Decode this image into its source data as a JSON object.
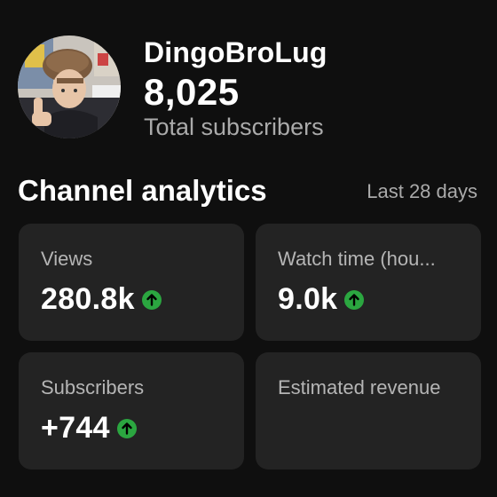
{
  "channel": {
    "name": "DingoBroLug",
    "subscriber_count": "8,025",
    "subscriber_label": "Total subscribers"
  },
  "analytics": {
    "title": "Channel analytics",
    "range": "Last 28 days",
    "cards": [
      {
        "label": "Views",
        "value": "280.8k",
        "trend": "up"
      },
      {
        "label": "Watch time (hou...",
        "value": "9.0k",
        "trend": "up"
      },
      {
        "label": "Subscribers",
        "value": "+744",
        "trend": "up"
      },
      {
        "label": "Estimated revenue",
        "value": ""
      }
    ]
  },
  "colors": {
    "background": "#0f0f0f",
    "card": "#232323",
    "trend_up": "#2ba640",
    "secondary_text": "#aaaaaa"
  },
  "icons": {
    "trend_up": "arrow-up-circle-icon"
  }
}
